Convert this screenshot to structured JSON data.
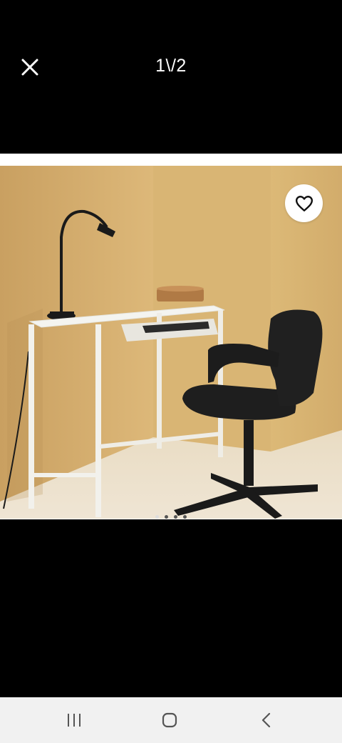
{
  "viewer": {
    "counter_text": "1\\/2",
    "close_icon": "close-icon",
    "favorite_icon": "heart-outline-icon",
    "image_alt": "",
    "page_count": 2,
    "current_page": 1
  },
  "nav_bar": {
    "recents_icon": "recents-icon",
    "home_icon": "home-icon",
    "back_icon": "back-icon"
  },
  "colors": {
    "background": "#000000",
    "frame": "#ffffff",
    "wall": "#d8b677",
    "floor": "#e7dcc8",
    "nav_bar": "#f1f1f1",
    "icon_dark": "#111111"
  }
}
